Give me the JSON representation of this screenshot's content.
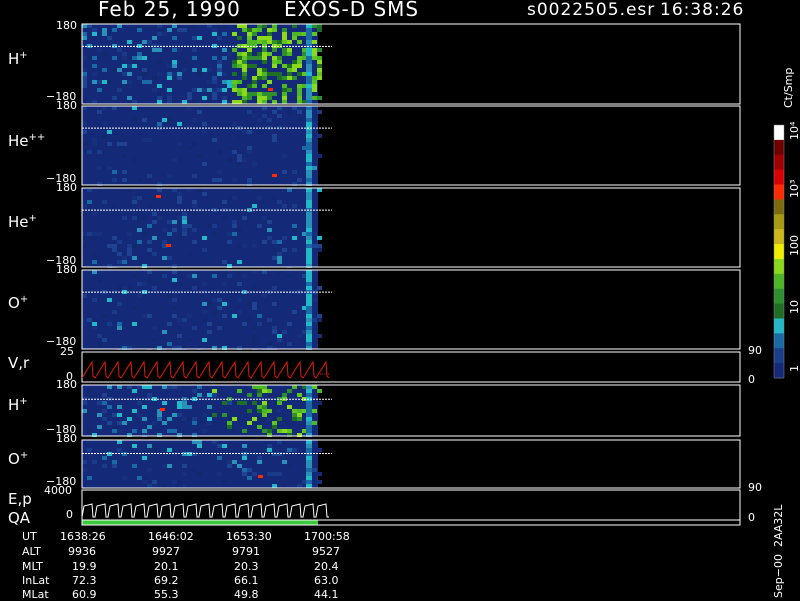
{
  "header": {
    "date": "Feb 25, 1990",
    "instrument": "EXOS-D SMS",
    "file": "s0022505.esr",
    "time": "16:38:26"
  },
  "panels": [
    {
      "id": "hplus1",
      "label": "H",
      "sup": "+",
      "ymax": "180",
      "ymin": "−180"
    },
    {
      "id": "hepp",
      "label": "He",
      "sup": "++",
      "ymax": "180",
      "ymin": "−180"
    },
    {
      "id": "heplus",
      "label": "He",
      "sup": "+",
      "ymax": "180",
      "ymin": "−180"
    },
    {
      "id": "oplus1",
      "label": "O",
      "sup": "+",
      "ymax": "180",
      "ymin": "−180"
    },
    {
      "id": "vr",
      "label": "V,r",
      "ymax": "25",
      "ymin": "0",
      "rmax": "90",
      "rmin": "0"
    },
    {
      "id": "hplus2",
      "label": "H",
      "sup": "+",
      "ymax": "180",
      "ymin": "−180"
    },
    {
      "id": "oplus2",
      "label": "O",
      "sup": "+",
      "ymax": "180",
      "ymin": "−180"
    },
    {
      "id": "ep",
      "label": "E,p",
      "ymax": "4000",
      "ymin": "0",
      "rmax": "90",
      "rmin": "0"
    },
    {
      "id": "qa",
      "label": "QA"
    }
  ],
  "colorbar": {
    "unit": "Ct/Smp",
    "ticks": [
      "10⁴",
      "10³",
      "100",
      "10",
      "1"
    ],
    "colors": [
      "#ffffff",
      "#6e0000",
      "#a00000",
      "#d80000",
      "#ff2b00",
      "#7a6a10",
      "#a89a10",
      "#ccb81a",
      "#f0ee00",
      "#8cd81c",
      "#4cb624",
      "#2f8f2f",
      "#1f6e26",
      "#22b8c8",
      "#1a6aa8",
      "#1a3f8a",
      "#142a78"
    ]
  },
  "ephemeris": {
    "rows": [
      {
        "name": "UT",
        "values": [
          "1638:26",
          "1646:02",
          "1653:30",
          "1700:58"
        ]
      },
      {
        "name": "ALT",
        "values": [
          "9936",
          "9927",
          "9791",
          "9527"
        ]
      },
      {
        "name": "MLT",
        "values": [
          "19.9",
          "20.1",
          "20.3",
          "20.4"
        ]
      },
      {
        "name": "InLat",
        "values": [
          "72.3",
          "69.2",
          "66.1",
          "63.0"
        ]
      },
      {
        "name": "MLat",
        "values": [
          "60.9",
          "55.3",
          "49.8",
          "44.1"
        ]
      }
    ]
  },
  "footer": {
    "version": "Sep−00  2AA32L"
  },
  "chart_data": {
    "type": "heatmap",
    "title": "Feb 25, 1990   EXOS-D SMS",
    "x_ticks_ut": [
      "1638:26",
      "1646:02",
      "1653:30",
      "1700:58"
    ],
    "ylim_angle": [
      -180,
      180
    ],
    "color_scale": "log",
    "zlim": [
      1,
      10000
    ],
    "series": [
      {
        "name": "H+",
        "data_end_ut": "1700:58"
      },
      {
        "name": "He++",
        "data_end_ut": "1700:58"
      },
      {
        "name": "He+",
        "data_end_ut": "1700:58"
      },
      {
        "name": "O+",
        "data_end_ut": "1700:58"
      },
      {
        "name": "V,r",
        "ylim": [
          0,
          25
        ],
        "rlim": [
          0,
          90
        ]
      },
      {
        "name": "H+"
      },
      {
        "name": "O+"
      },
      {
        "name": "E,p",
        "ylim": [
          0,
          4000
        ],
        "rlim": [
          0,
          90
        ]
      }
    ]
  }
}
